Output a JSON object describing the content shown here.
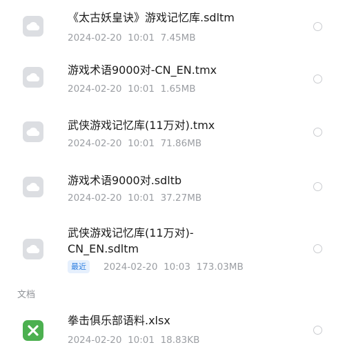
{
  "files": [
    {
      "name": "《太古妖皇诀》游戏记忆库.sdltm",
      "date": "2024-02-20",
      "time": "10:01",
      "size": "7.45MB",
      "icon": "cloud-file-icon"
    },
    {
      "name": "游戏术语9000对-CN_EN.tmx",
      "date": "2024-02-20",
      "time": "10:01",
      "size": "1.65MB",
      "icon": "cloud-file-icon"
    },
    {
      "name": "武侠游戏记忆库(11万对).tmx",
      "date": "2024-02-20",
      "time": "10:01",
      "size": "71.86MB",
      "icon": "cloud-file-icon"
    },
    {
      "name": "游戏术语9000对.sdltb",
      "date": "2024-02-20",
      "time": "10:01",
      "size": "37.27MB",
      "icon": "cloud-file-icon"
    },
    {
      "name": "武侠游戏记忆库(11万对)-CN_EN.sdltm",
      "badge": "最近",
      "date": "2024-02-20",
      "time": "10:03",
      "size": "173.03MB",
      "icon": "cloud-file-icon"
    }
  ],
  "section_documents": "文档",
  "documents": [
    {
      "name": "拳击俱乐部语料.xlsx",
      "date": "2024-02-20",
      "time": "10:01",
      "size": "18.83KB",
      "icon": "excel-file-icon"
    }
  ],
  "colors": {
    "icon_bg": "#dcdee2",
    "excel_green": "#4cb050",
    "badge_blue": "#2b7de0",
    "badge_bg": "#e6f0fd",
    "meta_gray": "#9b9ea3"
  }
}
